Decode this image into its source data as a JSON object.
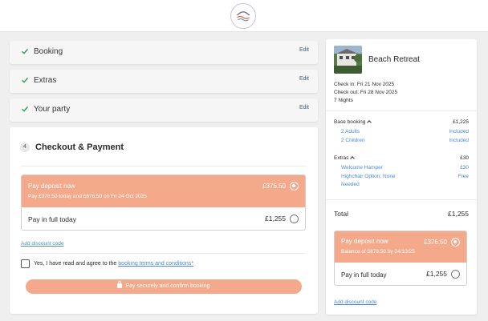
{
  "brand": {
    "logo_icon": "brand-logo-icon"
  },
  "steps": [
    {
      "label": "Booking",
      "edit": "Edit"
    },
    {
      "label": "Extras",
      "edit": "Edit"
    },
    {
      "label": "Your party",
      "edit": "Edit"
    }
  ],
  "payment": {
    "step_number": "4",
    "title": "Checkout & Payment",
    "deposit": {
      "label": "Pay deposit now",
      "amount": "£376.50",
      "detail": "Pay £376.50 today and £878.50 on Fri 24 Oct 2025",
      "selected": true
    },
    "full": {
      "label": "Pay in full today",
      "amount": "£1,255",
      "selected": false
    },
    "discount_link": "Add discount code",
    "agree_text": "Yes, I have read and agree to the ",
    "terms_link": "booking terms and conditions*",
    "confirm_label": "Pay securely and confirm booking"
  },
  "summary": {
    "property_name": "Beach Retreat",
    "check_in": "Check in: Fri 21 Nov 2025",
    "check_out": "Check out: Fri 28 Nov 2025",
    "nights": "7 Nights",
    "base_booking": {
      "label": "Base booking",
      "amount": "£1,225"
    },
    "adults": {
      "label": "2 Adults",
      "value": "Included"
    },
    "children": {
      "label": "2 Children",
      "value": "Included"
    },
    "extras": {
      "label": "Extras",
      "amount": "£30"
    },
    "hamper": {
      "label": "Welcome Hamper",
      "value": "£30"
    },
    "highchair": {
      "label1": "Highchair Option: None",
      "label2": "Needed",
      "value": "Free"
    },
    "total_label": "Total",
    "total_amount": "£1,255",
    "deposit": {
      "label": "Pay deposit now",
      "amount": "£376.50",
      "detail": "Balance of £878.50 by 24/10/25",
      "selected": true
    },
    "full": {
      "label": "Pay in full today",
      "amount": "£1,255",
      "selected": false
    },
    "discount_link": "Add discount code"
  },
  "colors": {
    "accent": "#f5a98b",
    "link": "#4a8ad8",
    "check": "#2e9d5b"
  }
}
